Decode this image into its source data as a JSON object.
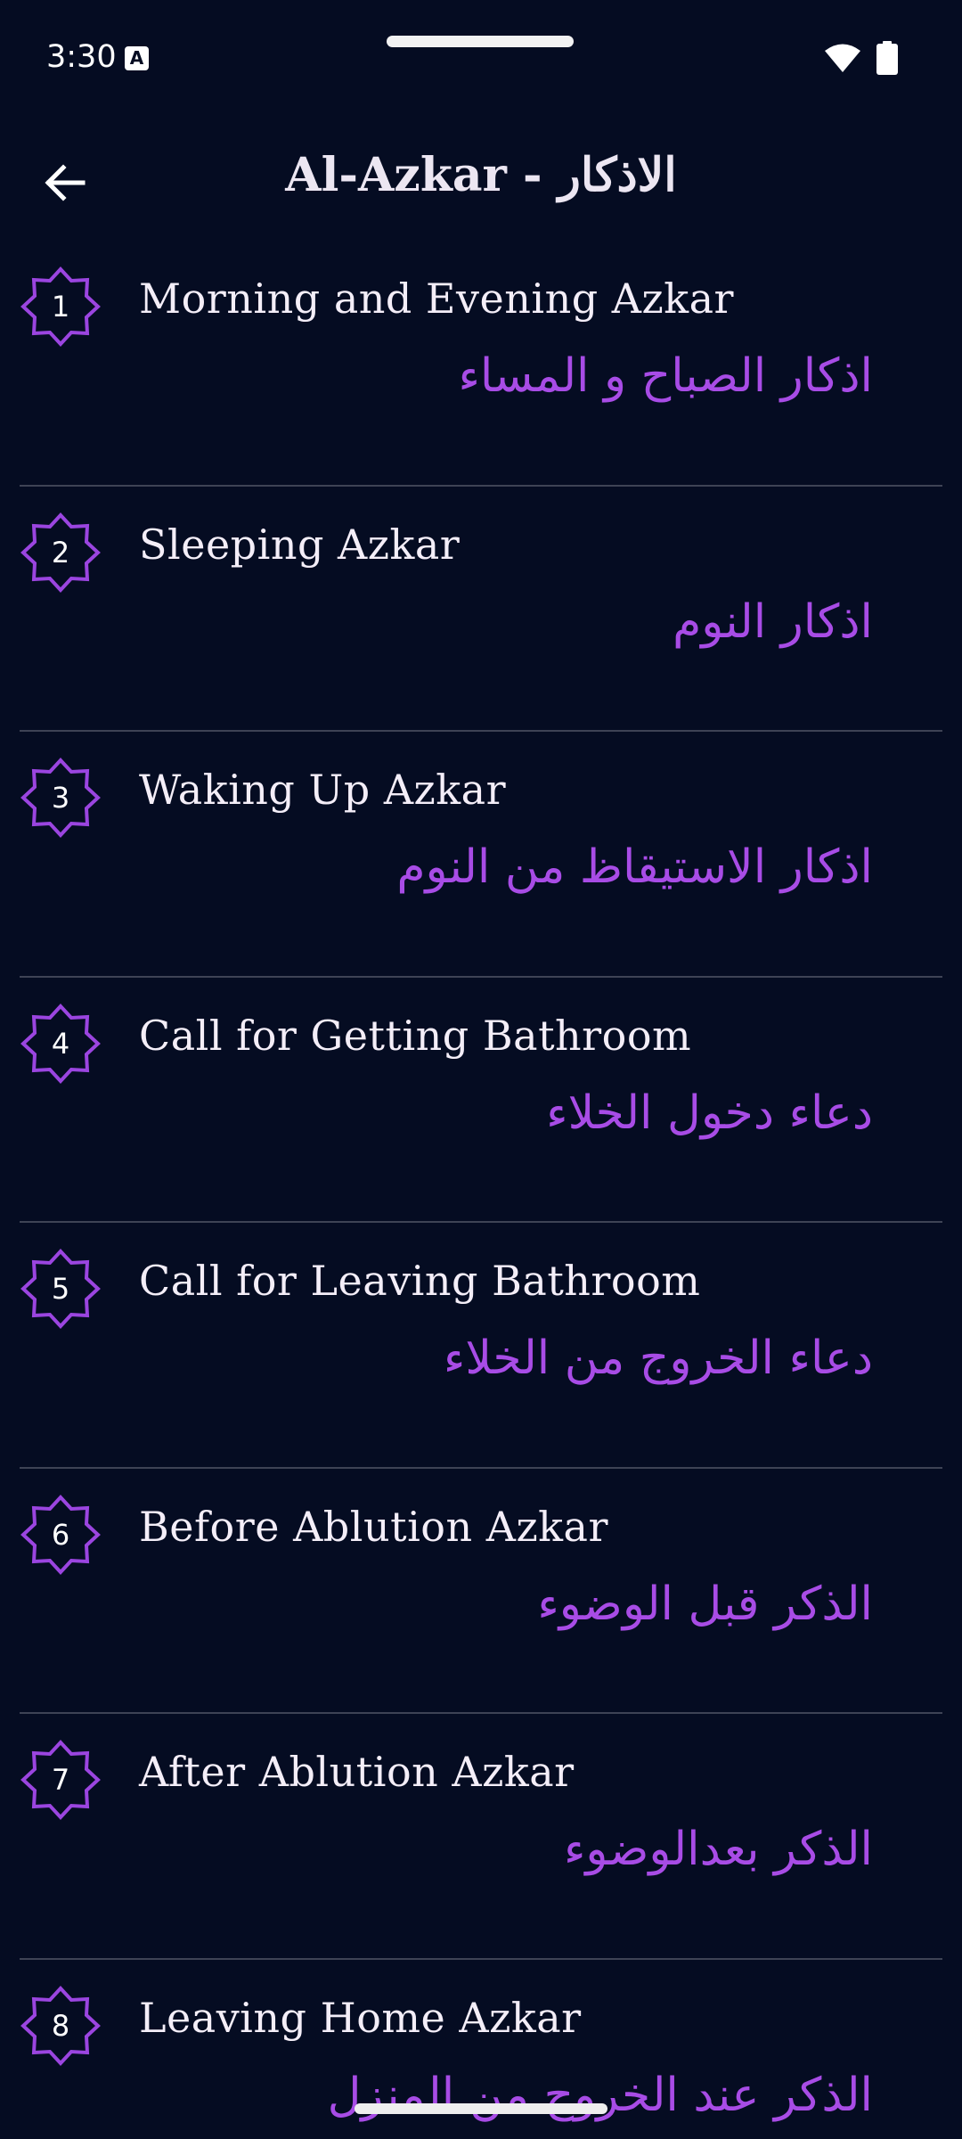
{
  "status_bar": {
    "time": "3:30",
    "notification_icon": "a-notification-icon",
    "wifi_icon": "wifi-icon",
    "battery_icon": "battery-icon"
  },
  "app_bar": {
    "back_icon": "arrow-back-icon",
    "title": "Al-Azkar - الاذكار"
  },
  "colors": {
    "background": "#050c22",
    "accent": "#a84ce6",
    "badge_stroke": "#9b45e0",
    "divider": "#3e4355"
  },
  "items": [
    {
      "number": "1",
      "title_en": "Morning and Evening Azkar",
      "title_ar": "اذكار الصباح و المساء"
    },
    {
      "number": "2",
      "title_en": "Sleeping Azkar",
      "title_ar": "اذكار النوم"
    },
    {
      "number": "3",
      "title_en": "Waking Up Azkar",
      "title_ar": "اذكار الاستيقاظ من النوم"
    },
    {
      "number": "4",
      "title_en": "Call for Getting Bathroom",
      "title_ar": "دعاء دخول الخلاء"
    },
    {
      "number": "5",
      "title_en": "Call for Leaving Bathroom",
      "title_ar": "دعاء الخروج من الخلاء"
    },
    {
      "number": "6",
      "title_en": "Before Ablution Azkar",
      "title_ar": "الذكر قبل الوضوء"
    },
    {
      "number": "7",
      "title_en": "After Ablution Azkar",
      "title_ar": "الذكر بعدالوضوء"
    },
    {
      "number": "8",
      "title_en": "Leaving Home Azkar",
      "title_ar": "الذكر عند الخروج من المنزل"
    }
  ]
}
